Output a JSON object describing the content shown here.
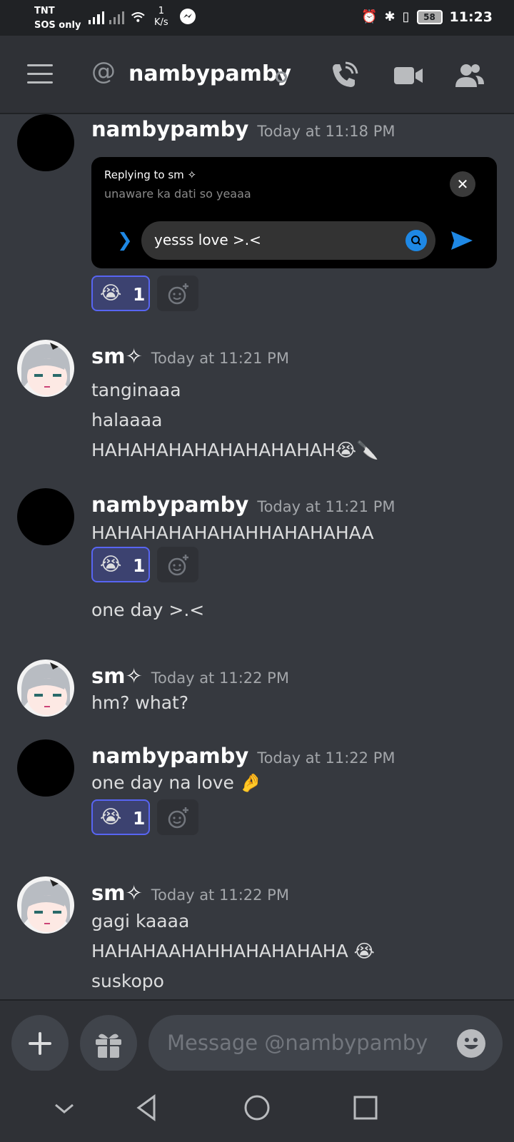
{
  "status_bar": {
    "carrier_line1": "TNT",
    "carrier_line2": "SOS only",
    "speed_value": "1",
    "speed_unit": "K/s",
    "battery": "58",
    "time": "11:23"
  },
  "header": {
    "at_symbol": "@",
    "channel_name": "nambypamby"
  },
  "embed": {
    "reply_label": "Replying to sm ✧",
    "reply_preview": "unaware ka dati so yeaaa",
    "input_text": "yesss love >.<",
    "close_glyph": "✕",
    "chevron_glyph": "❯"
  },
  "messages": [
    {
      "author": "nambypamby",
      "timestamp": "Today at 11:18 PM"
    },
    {
      "author": "sm✧",
      "timestamp": "Today at 11:21 PM",
      "lines": [
        "tanginaaa",
        "halaaaa",
        "HAHAHAHAHAHAHAHAHAH😭🔪"
      ]
    },
    {
      "author": "nambypamby",
      "timestamp": "Today at 11:21 PM",
      "lines": [
        "HAHAHAHAHAHAHHAHAHAHAA",
        "one day >.<"
      ]
    },
    {
      "author": "sm✧",
      "timestamp": "Today at 11:22 PM",
      "lines": [
        "hm? what?"
      ]
    },
    {
      "author": "nambypamby",
      "timestamp": "Today at 11:22 PM",
      "lines": [
        "one day na love 🤌"
      ]
    },
    {
      "author": "sm✧",
      "timestamp": "Today at 11:22 PM",
      "lines": [
        "gagi kaaaa",
        "HAHAHAAHAHHAHAHAHAHA 😭",
        "suskopo"
      ]
    }
  ],
  "reactions": {
    "emoji": "😭",
    "count": "1"
  },
  "composer": {
    "placeholder": "Message @nambypamby"
  },
  "colors": {
    "background": "#36393f",
    "header": "#2f3136",
    "reaction_border": "#5865f2",
    "send_blue": "#1e88e5"
  }
}
